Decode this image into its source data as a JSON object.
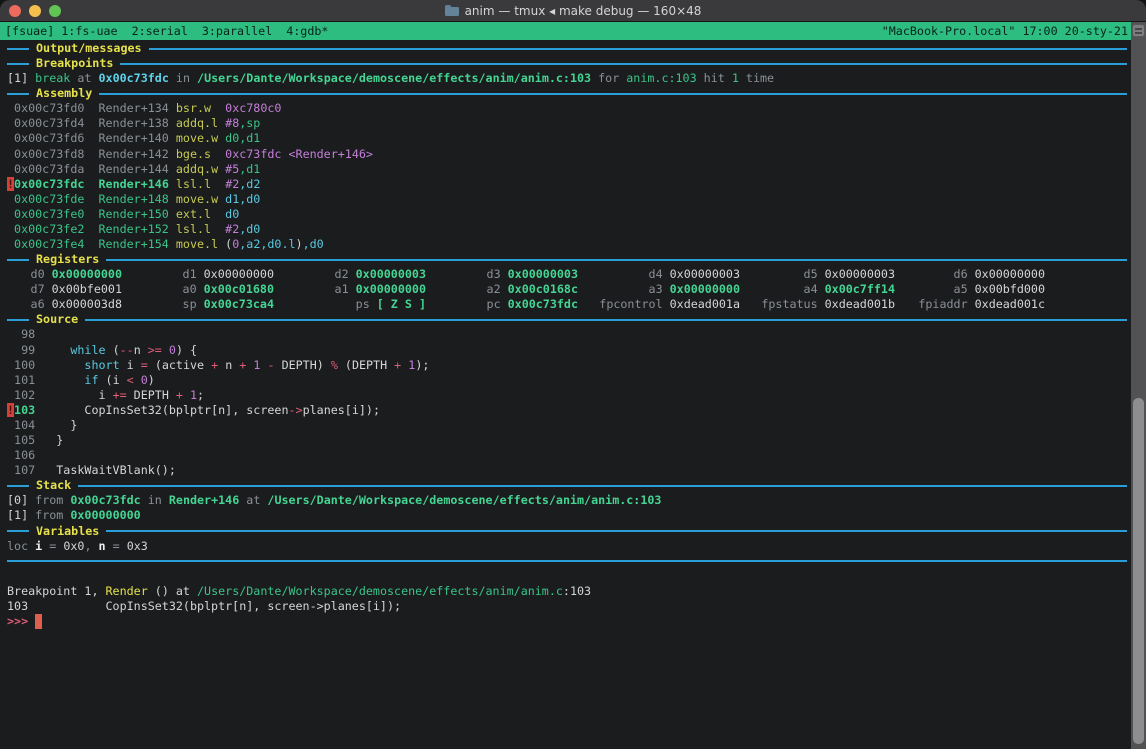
{
  "window": {
    "title": "anim — tmux ◂ make debug — 160×48"
  },
  "tmux_bar": {
    "session": "[fsuae]",
    "windows": [
      "1:fs-uae",
      "2:serial",
      "3:parallel",
      "4:gdb*"
    ],
    "right": "\"MacBook-Pro.local\" 17:00 20-sty-21"
  },
  "colors": {
    "background": "#1a1c1e",
    "tmux_green": "#2ebd81",
    "divider_blue": "#2a9ed6",
    "section_yellow": "#e6e14b",
    "green": "#3bc488",
    "cyan": "#5ac8e0",
    "purple": "#c47fd8",
    "pink": "#e25d77",
    "mnemonic": "#c6ca51",
    "marker_red": "#d1423a",
    "cursor_red": "#de5f4e"
  },
  "terminal": {
    "lines": [
      {
        "type": "divider",
        "name": "section-output-messages",
        "label": "Output/messages"
      },
      {
        "type": "divider",
        "name": "section-breakpoints",
        "label": "Breakpoints"
      },
      {
        "name": "breakpoint-entry",
        "s": [
          [
            "w",
            "[1] "
          ],
          [
            "gn",
            "break"
          ],
          [
            "gy",
            " at "
          ],
          [
            "cyb",
            "0x00c73fdc"
          ],
          [
            "gy",
            " in "
          ],
          [
            "gnb",
            "/Users/Dante/Workspace/demoscene/effects/anim/anim.c:103"
          ],
          [
            "gy",
            " for "
          ],
          [
            "gn",
            "anim.c:103"
          ],
          [
            "gy",
            " hit "
          ],
          [
            "gn",
            "1"
          ],
          [
            "gy",
            " time"
          ]
        ]
      },
      {
        "type": "divider",
        "name": "section-assembly",
        "label": "Assembly"
      },
      {
        "name": "asm-line",
        "s": [
          [
            "gy",
            " 0x00c73fd0  Render+134 "
          ],
          [
            "mn",
            "bsr.w  "
          ],
          [
            "pu",
            "0xc780c0"
          ]
        ]
      },
      {
        "name": "asm-line",
        "s": [
          [
            "gy",
            " 0x00c73fd4  Render+138 "
          ],
          [
            "mn",
            "addq.l "
          ],
          [
            "pu",
            "#8"
          ],
          [
            "gn",
            ",sp"
          ]
        ]
      },
      {
        "name": "asm-line",
        "s": [
          [
            "gy",
            " 0x00c73fd6  Render+140 "
          ],
          [
            "mn",
            "move.w "
          ],
          [
            "gn",
            "d0,d1"
          ]
        ]
      },
      {
        "name": "asm-line",
        "s": [
          [
            "gy",
            " 0x00c73fd8  Render+142 "
          ],
          [
            "mn",
            "bge.s  "
          ],
          [
            "pu",
            "0xc73fdc"
          ],
          [
            "w",
            " "
          ],
          [
            "pu",
            "<Render+146>"
          ]
        ]
      },
      {
        "name": "asm-line",
        "s": [
          [
            "gy",
            " 0x00c73fda  Render+144 "
          ],
          [
            "mn",
            "addq.w "
          ],
          [
            "pu",
            "#5"
          ],
          [
            "gn",
            ",d1"
          ]
        ]
      },
      {
        "name": "asm-line-current",
        "s": [
          [
            "mk",
            "!"
          ],
          [
            "gnb",
            "0x00c73fdc"
          ],
          [
            "w",
            "  "
          ],
          [
            "gnb",
            "Render+146"
          ],
          [
            "w",
            " "
          ],
          [
            "mn",
            "lsl.l  "
          ],
          [
            "pu",
            "#2"
          ],
          [
            "cy",
            ",d2"
          ]
        ]
      },
      {
        "name": "asm-line",
        "s": [
          [
            "gn",
            " 0x00c73fde  Render+148 "
          ],
          [
            "mn",
            "move.w "
          ],
          [
            "cy",
            "d1,d0"
          ]
        ]
      },
      {
        "name": "asm-line",
        "s": [
          [
            "gn",
            " 0x00c73fe0  Render+150 "
          ],
          [
            "mn",
            "ext.l  "
          ],
          [
            "cy",
            "d0"
          ]
        ]
      },
      {
        "name": "asm-line",
        "s": [
          [
            "gn",
            " 0x00c73fe2  Render+152 "
          ],
          [
            "mn",
            "lsl.l  "
          ],
          [
            "pu",
            "#2"
          ],
          [
            "cy",
            ",d0"
          ]
        ]
      },
      {
        "name": "asm-line",
        "s": [
          [
            "gn",
            " 0x00c73fe4  Render+154 "
          ],
          [
            "mn",
            "move.l "
          ],
          [
            "w",
            "("
          ],
          [
            "pu",
            "0"
          ],
          [
            "cy",
            ",a2,d0.l"
          ],
          [
            "w",
            ")"
          ],
          [
            "cy",
            ",d0"
          ]
        ]
      },
      {
        "type": "divider",
        "name": "section-registers",
        "label": "Registers"
      },
      {
        "type": "registers",
        "name": "register-row-1",
        "cells": [
          {
            "n": "d0",
            "v": "0x00000000",
            "c": true
          },
          {
            "n": "d1",
            "v": "0x00000000",
            "c": false
          },
          {
            "n": "d2",
            "v": "0x00000003",
            "c": true
          },
          {
            "n": "d3",
            "v": "0x00000003",
            "c": true
          },
          {
            "n": "d4",
            "v": "0x00000003",
            "c": false
          },
          {
            "n": "d5",
            "v": "0x00000003",
            "c": false
          },
          {
            "n": "d6",
            "v": "0x00000000",
            "c": false
          }
        ]
      },
      {
        "type": "registers",
        "name": "register-row-2",
        "cells": [
          {
            "n": "d7",
            "v": "0x00bfe001",
            "c": false
          },
          {
            "n": "a0",
            "v": "0x00c01680",
            "c": true
          },
          {
            "n": "a1",
            "v": "0x00000000",
            "c": true
          },
          {
            "n": "a2",
            "v": "0x00c0168c",
            "c": true
          },
          {
            "n": "a3",
            "v": "0x00000000",
            "c": true
          },
          {
            "n": "a4",
            "v": "0x00c7ff14",
            "c": true
          },
          {
            "n": "a5",
            "v": "0x00bfd000",
            "c": false
          }
        ]
      },
      {
        "type": "registers",
        "name": "register-row-3",
        "cells": [
          {
            "n": "a6",
            "v": "0x000003d8",
            "c": false
          },
          {
            "n": "sp",
            "v": "0x00c73ca4",
            "c": true
          },
          {
            "n": "ps",
            "v": "[ Z S ]",
            "c": true
          },
          {
            "n": "pc",
            "v": "0x00c73fdc",
            "c": true
          },
          {
            "n": "fpcontrol",
            "v": "0xdead001a",
            "c": false
          },
          {
            "n": "fpstatus",
            "v": "0xdead001b",
            "c": false
          },
          {
            "n": "fpiaddr",
            "v": "0xdead001c",
            "c": false
          }
        ]
      },
      {
        "type": "divider",
        "name": "section-source",
        "label": "Source"
      },
      {
        "name": "source-line",
        "s": [
          [
            "gy",
            "  98"
          ]
        ]
      },
      {
        "name": "source-line",
        "s": [
          [
            "gy",
            "  99 "
          ],
          [
            "w",
            "    "
          ],
          [
            "cy",
            "while"
          ],
          [
            "w",
            " ("
          ],
          [
            "pk",
            "--"
          ],
          [
            "w",
            "n "
          ],
          [
            "pk",
            ">="
          ],
          [
            "w",
            " "
          ],
          [
            "pu",
            "0"
          ],
          [
            "w",
            ") {"
          ]
        ]
      },
      {
        "name": "source-line",
        "s": [
          [
            "gy",
            " 100 "
          ],
          [
            "w",
            "      "
          ],
          [
            "cy",
            "short"
          ],
          [
            "w",
            " i "
          ],
          [
            "pk",
            "="
          ],
          [
            "w",
            " (active "
          ],
          [
            "pk",
            "+"
          ],
          [
            "w",
            " n "
          ],
          [
            "pk",
            "+"
          ],
          [
            "w",
            " "
          ],
          [
            "pu",
            "1"
          ],
          [
            "w",
            " "
          ],
          [
            "pk",
            "-"
          ],
          [
            "w",
            " DEPTH) "
          ],
          [
            "pk",
            "%"
          ],
          [
            "w",
            " (DEPTH "
          ],
          [
            "pk",
            "+"
          ],
          [
            "w",
            " "
          ],
          [
            "pu",
            "1"
          ],
          [
            "w",
            ");"
          ]
        ]
      },
      {
        "name": "source-line",
        "s": [
          [
            "gy",
            " 101 "
          ],
          [
            "w",
            "      "
          ],
          [
            "cy",
            "if"
          ],
          [
            "w",
            " (i "
          ],
          [
            "pk",
            "<"
          ],
          [
            "w",
            " "
          ],
          [
            "pu",
            "0"
          ],
          [
            "w",
            ")"
          ]
        ]
      },
      {
        "name": "source-line",
        "s": [
          [
            "gy",
            " 102 "
          ],
          [
            "w",
            "        i "
          ],
          [
            "pk",
            "+="
          ],
          [
            "w",
            " DEPTH "
          ],
          [
            "pk",
            "+"
          ],
          [
            "w",
            " "
          ],
          [
            "pu",
            "1"
          ],
          [
            "w",
            ";"
          ]
        ]
      },
      {
        "name": "source-line-current",
        "s": [
          [
            "mk",
            "!"
          ],
          [
            "gnb",
            "103"
          ],
          [
            "w",
            "       CopInsSet32(bplptr[n], screen"
          ],
          [
            "pk",
            "->"
          ],
          [
            "w",
            "planes[i]);"
          ]
        ]
      },
      {
        "name": "source-line",
        "s": [
          [
            "gy",
            " 104 "
          ],
          [
            "w",
            "    }"
          ]
        ]
      },
      {
        "name": "source-line",
        "s": [
          [
            "gy",
            " 105 "
          ],
          [
            "w",
            "  }"
          ]
        ]
      },
      {
        "name": "source-line",
        "s": [
          [
            "gy",
            " 106"
          ]
        ]
      },
      {
        "name": "source-line",
        "s": [
          [
            "gy",
            " 107 "
          ],
          [
            "w",
            "  TaskWaitVBlank();"
          ]
        ]
      },
      {
        "type": "divider",
        "name": "section-stack",
        "label": "Stack"
      },
      {
        "name": "stack-frame-0",
        "s": [
          [
            "w",
            "[0] "
          ],
          [
            "gy",
            "from "
          ],
          [
            "gnb",
            "0x00c73fdc"
          ],
          [
            "gy",
            " in "
          ],
          [
            "gnb",
            "Render+146"
          ],
          [
            "gy",
            " at "
          ],
          [
            "gnb",
            "/Users/Dante/Workspace/demoscene/effects/anim/anim.c:103"
          ]
        ]
      },
      {
        "name": "stack-frame-1",
        "s": [
          [
            "w",
            "[1] "
          ],
          [
            "gy",
            "from "
          ],
          [
            "gnb",
            "0x00000000"
          ]
        ]
      },
      {
        "type": "divider",
        "name": "section-variables",
        "label": "Variables"
      },
      {
        "name": "variables-line",
        "s": [
          [
            "gy",
            "loc "
          ],
          [
            "wb",
            "i"
          ],
          [
            "gy",
            " = "
          ],
          [
            "w",
            "0x0"
          ],
          [
            "gy",
            ","
          ],
          [
            "wb",
            " n"
          ],
          [
            "gy",
            " = "
          ],
          [
            "w",
            "0x3"
          ]
        ]
      },
      {
        "type": "divider",
        "name": "dashboard-bottom-divider",
        "label": ""
      },
      {
        "name": "blank-line",
        "s": []
      },
      {
        "name": "gdb-breakpoint-message",
        "s": [
          [
            "w",
            "Breakpoint 1, "
          ],
          [
            "ye",
            "Render"
          ],
          [
            "w",
            " () at "
          ],
          [
            "gn",
            "/Users/Dante/Workspace/demoscene/effects/anim/anim.c"
          ],
          [
            "w",
            ":103"
          ]
        ]
      },
      {
        "name": "gdb-source-echo",
        "s": [
          [
            "w",
            "103           CopInsSet32(bplptr[n], screen->planes[i]);"
          ]
        ]
      },
      {
        "name": "gdb-prompt",
        "cursor": true,
        "s": [
          [
            "pkb",
            ">>> "
          ]
        ]
      },
      {
        "name": "blank-line",
        "s": []
      },
      {
        "name": "blank-line",
        "s": []
      },
      {
        "name": "blank-line",
        "s": []
      },
      {
        "name": "blank-line",
        "s": []
      },
      {
        "name": "blank-line",
        "s": []
      },
      {
        "name": "blank-line",
        "s": []
      },
      {
        "name": "blank-line",
        "s": []
      },
      {
        "name": "blank-line",
        "s": []
      }
    ]
  }
}
